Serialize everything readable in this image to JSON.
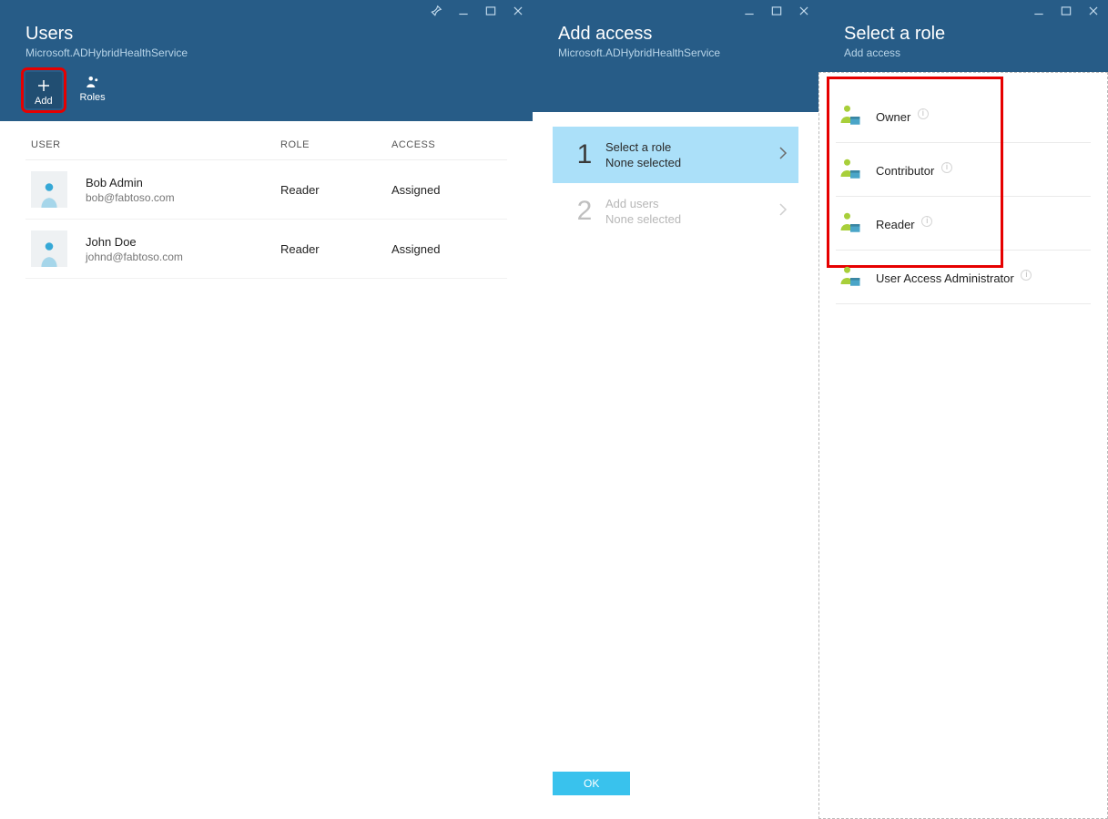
{
  "blade1": {
    "title": "Users",
    "subtitle": "Microsoft.ADHybridHealthService",
    "toolbar": {
      "add": "Add",
      "roles": "Roles"
    },
    "columns": {
      "user": "USER",
      "role": "ROLE",
      "access": "ACCESS"
    },
    "rows": [
      {
        "name": "Bob Admin",
        "email": "bob@fabtoso.com",
        "role": "Reader",
        "access": "Assigned"
      },
      {
        "name": "John Doe",
        "email": "johnd@fabtoso.com",
        "role": "Reader",
        "access": "Assigned"
      }
    ]
  },
  "blade2": {
    "title": "Add access",
    "subtitle": "Microsoft.ADHybridHealthService",
    "step1": {
      "num": "1",
      "title": "Select a role",
      "sub": "None selected"
    },
    "step2": {
      "num": "2",
      "title": "Add users",
      "sub": "None selected"
    },
    "ok": "OK"
  },
  "blade3": {
    "title": "Select a role",
    "subtitle": "Add access",
    "roles": {
      "r1": "Owner",
      "r2": "Contributor",
      "r3": "Reader",
      "r4": "User Access Administrator"
    }
  }
}
